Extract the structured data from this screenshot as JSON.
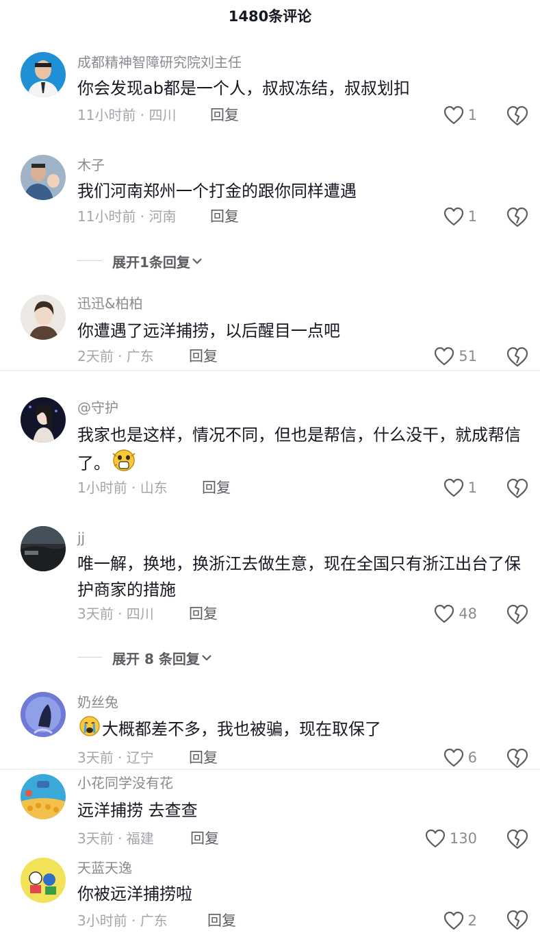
{
  "header": {
    "title": "1480条评论"
  },
  "comments": [
    {
      "name": "成都精神智障研究院刘主任",
      "text": "你会发现ab都是一个人，叔叔冻结，叔叔划扣",
      "meta": "11小时前 · 四川",
      "reply": "回复",
      "likes": "1"
    },
    {
      "name": "木子",
      "text": "我们河南郑州一个打金的跟你同样遭遇",
      "meta": "11小时前 · 河南",
      "reply": "回复",
      "likes": "1"
    },
    {
      "name": "迅迅&柏柏",
      "text": "你遭遇了远洋捕捞，以后醒目一点吧",
      "meta": "2天前 · 广东",
      "reply": "回复",
      "likes": "51"
    },
    {
      "name": "@守护",
      "text": "我家也是这样，情况不同，但也是帮信，什么没干，就成帮信了。",
      "meta": "1小时前 · 山东",
      "reply": "回复",
      "likes": "1"
    },
    {
      "name": "jj",
      "text": "唯一解，换地，换浙江去做生意，现在全国只有浙江出台了保护商家的措施",
      "meta": "3天前 · 四川",
      "reply": "回复",
      "likes": "48"
    },
    {
      "name": "奶丝兔",
      "text": "大概都差不多，我也被骗，现在取保了",
      "meta": "3天前 · 辽宁",
      "reply": "回复",
      "likes": "6"
    },
    {
      "name": "小花同学没有花",
      "text": "远洋捕捞 去查查",
      "meta": "3天前 · 福建",
      "reply": "回复",
      "likes": "130"
    },
    {
      "name": "天蓝天逸",
      "text": "你被远洋捕捞啦",
      "meta": "3小时前 · 广东",
      "reply": "回复",
      "likes": "2"
    }
  ],
  "expand_replies": [
    {
      "label": "展开1条回复"
    },
    {
      "label": "展开 8 条回复"
    }
  ],
  "icons": {
    "like": "heart-outline-icon",
    "dislike": "broken-heart-icon",
    "expand": "chevron-down-icon"
  },
  "colors": {
    "text": "#161823",
    "secondary": "#8a8b91",
    "meta": "#a4a5aa"
  }
}
